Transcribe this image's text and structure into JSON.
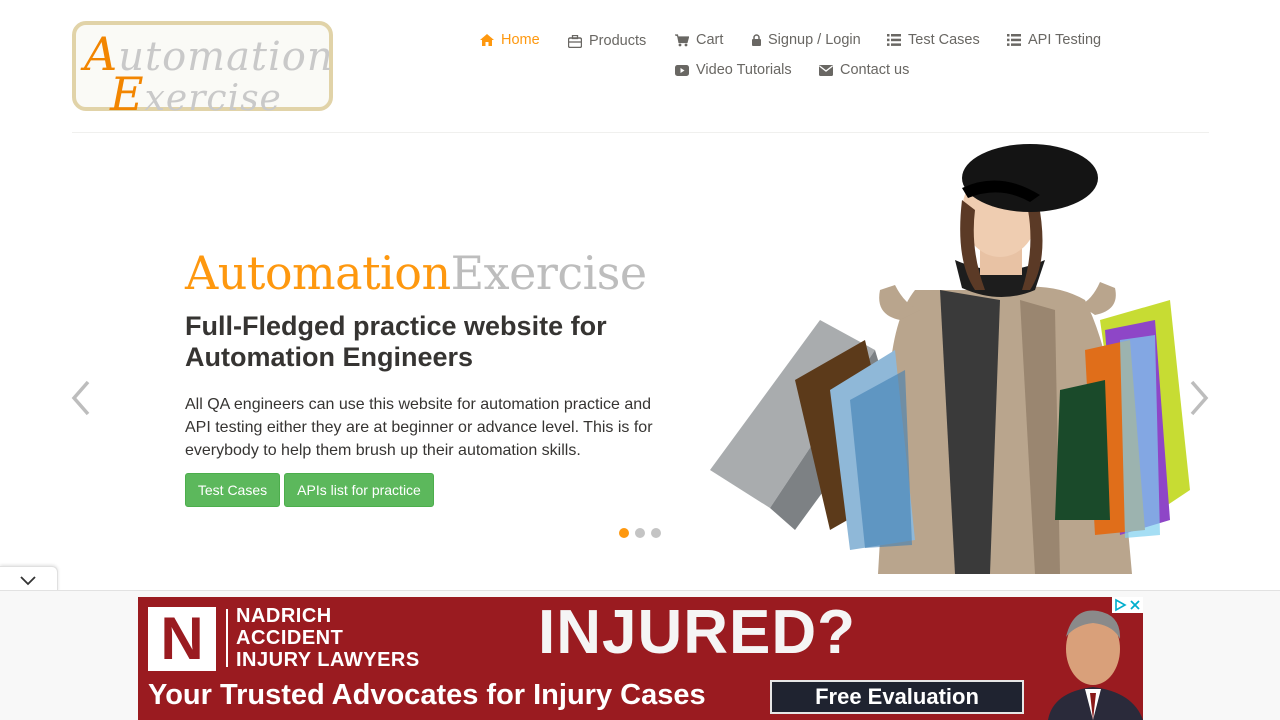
{
  "header": {
    "logo": {
      "line1_cap": "A",
      "line1_rest": "utomation",
      "line2_cap": "E",
      "line2_rest": "xercise"
    },
    "nav": [
      {
        "label": "Home",
        "icon": "home-icon",
        "active": true
      },
      {
        "label": "Products",
        "icon": "briefcase-icon",
        "active": false
      },
      {
        "label": "Cart",
        "icon": "cart-icon",
        "active": false
      },
      {
        "label": "Signup / Login",
        "icon": "lock-icon",
        "active": false
      },
      {
        "label": "Test Cases",
        "icon": "list-icon",
        "active": false
      },
      {
        "label": "API Testing",
        "icon": "list-icon",
        "active": false
      },
      {
        "label": "Video Tutorials",
        "icon": "youtube-icon",
        "active": false
      },
      {
        "label": "Contact us",
        "icon": "envelope-icon",
        "active": false
      }
    ]
  },
  "slider": {
    "brand_part1": "Automation",
    "brand_part2": "Exercise",
    "headline": "Full-Fledged practice website for Automation Engineers",
    "description": "All QA engineers can use this website for automation practice and API testing either they are at beginner or advance level. This is for everybody to help them brush up their automation skills.",
    "buttons": [
      "Test Cases",
      "APIs list for practice"
    ],
    "active_slide": 1,
    "slide_count": 3
  },
  "ad": {
    "firm_lines": [
      "NADRICH",
      "ACCIDENT",
      "INJURY LAWYERS"
    ],
    "logo_letter": "N",
    "headline": "INJURED?",
    "tagline": "Your Trusted Advocates for Injury Cases",
    "cta": "Free Evaluation"
  },
  "colors": {
    "accent": "#fe980f",
    "button_green": "#5cb85c",
    "text_dark": "#363432",
    "text_muted": "#696763",
    "ad_red": "#9a1b20"
  }
}
